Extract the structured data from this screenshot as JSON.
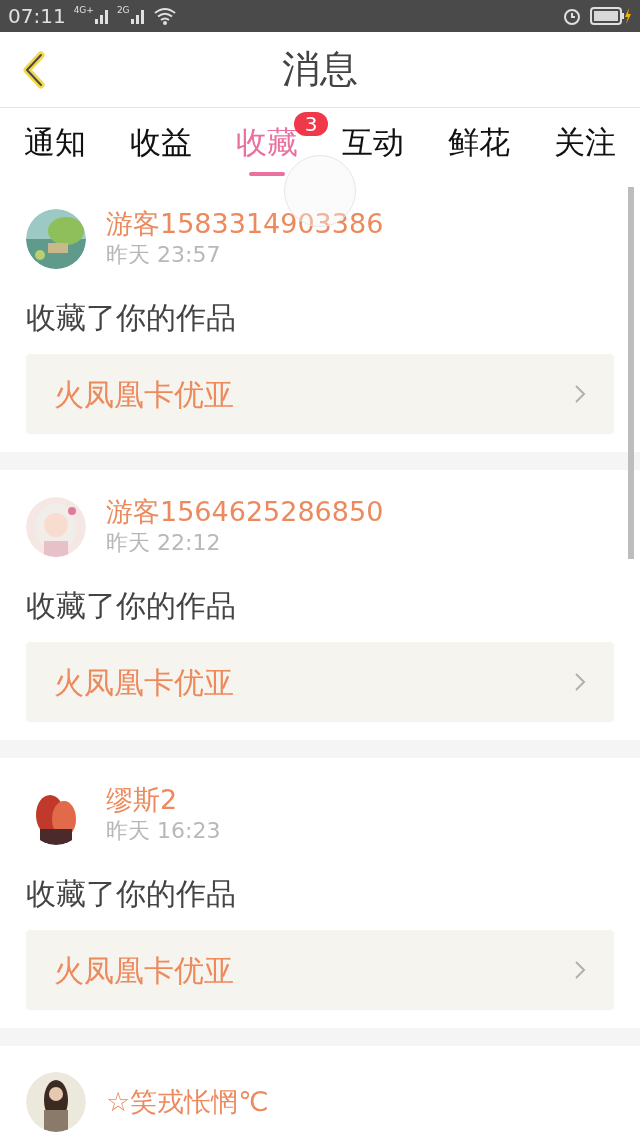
{
  "status_bar": {
    "time": "07:11",
    "network_1": "4G+",
    "network_2": "2G"
  },
  "header": {
    "title": "消息"
  },
  "tabs": [
    {
      "label": "通知",
      "selected": false
    },
    {
      "label": "收益",
      "selected": false
    },
    {
      "label": "收藏",
      "selected": true,
      "badge": "3"
    },
    {
      "label": "互动",
      "selected": false
    },
    {
      "label": "鲜花",
      "selected": false
    },
    {
      "label": "关注",
      "selected": false
    }
  ],
  "messages": [
    {
      "user": "游客1583314903386",
      "time": "昨天 23:57",
      "action": "收藏了你的作品",
      "work": "火凤凰卡优亚"
    },
    {
      "user": "游客1564625286850",
      "time": "昨天 22:12",
      "action": "收藏了你的作品",
      "work": "火凤凰卡优亚"
    },
    {
      "user": "缪斯2",
      "time": "昨天 16:23",
      "action": "收藏了你的作品",
      "work": "火凤凰卡优亚"
    },
    {
      "user": "☆笑戎怅惘℃"
    }
  ]
}
